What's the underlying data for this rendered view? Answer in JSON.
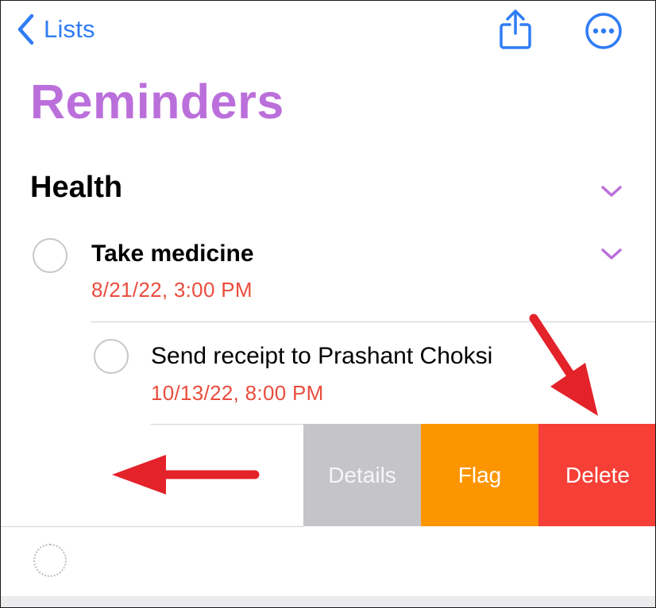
{
  "nav": {
    "back_label": "Lists",
    "share_icon": "share-icon",
    "more_icon": "more-icon"
  },
  "list": {
    "title": "Reminders",
    "title_color": "#bb6fdb"
  },
  "section": {
    "name": "Health"
  },
  "reminders": [
    {
      "title": "Take medicine",
      "due": "8/21/22, 3:00 PM"
    }
  ],
  "subtasks": [
    {
      "title": "Send receipt to Prashant Choksi",
      "due": "10/13/22, 8:00 PM"
    }
  ],
  "swipe_actions": {
    "details_label": "Details",
    "flag_label": "Flag",
    "delete_label": "Delete",
    "details_color": "#c5c5c9",
    "flag_color": "#fd9500",
    "delete_color": "#f63f36"
  },
  "colors": {
    "accent_blue": "#2f7cf6",
    "date_red": "#ea4d3d",
    "annotation_red": "#e3222a"
  }
}
